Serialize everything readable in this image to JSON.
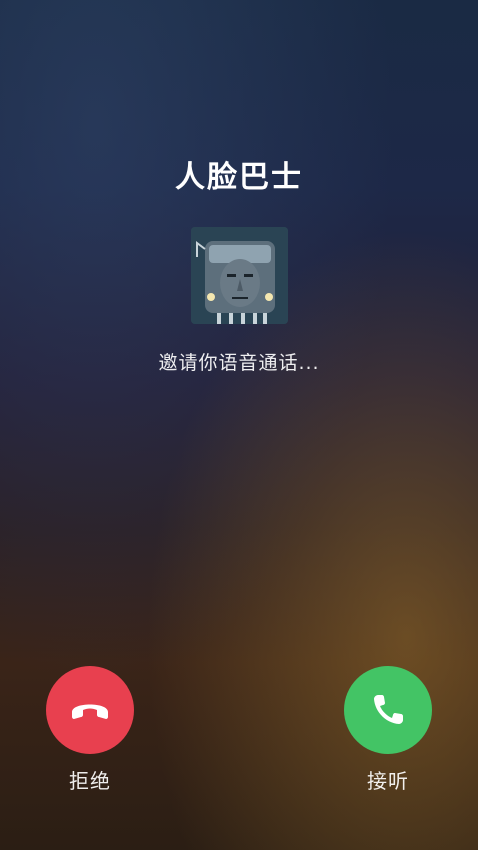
{
  "call": {
    "contact_name": "人脸巴士",
    "status": "邀请你语音通话...",
    "avatar_icon": "bus-face-avatar"
  },
  "actions": {
    "decline_label": "拒绝",
    "accept_label": "接听",
    "decline_color": "#e8404f",
    "accept_color": "#43c465",
    "decline_icon": "hang-up-phone-icon",
    "accept_icon": "phone-icon"
  }
}
